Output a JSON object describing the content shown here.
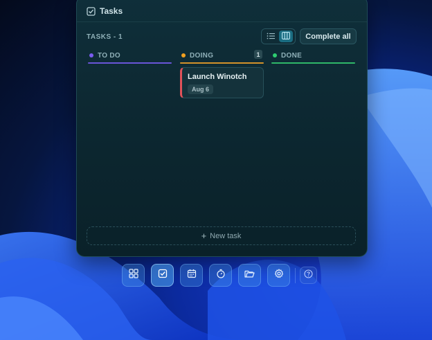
{
  "header": {
    "title": "Tasks",
    "icon": "checkbox-icon"
  },
  "toolbar": {
    "count_label": "TASKS - 1",
    "complete_all_label": "Complete all",
    "view_modes": [
      "list-view-icon",
      "board-view-icon"
    ],
    "active_view": "board"
  },
  "columns": [
    {
      "title": "TO DO",
      "color": "#7a5cf0",
      "count": ""
    },
    {
      "title": "DOING",
      "color": "#f0a020",
      "count": "1"
    },
    {
      "title": "DONE",
      "color": "#2ecc71",
      "count": ""
    }
  ],
  "tasks": [
    {
      "title": "Launch Winotch",
      "date": "Aug 6",
      "column": "DOING",
      "priority_color": "#e0525a"
    }
  ],
  "new_task": {
    "label": "New task"
  },
  "dock": {
    "items": [
      "grid-icon",
      "tasks-icon",
      "calendar-icon",
      "timer-icon",
      "folder-icon",
      "settings-icon",
      "help-icon"
    ],
    "active": "tasks-icon"
  }
}
